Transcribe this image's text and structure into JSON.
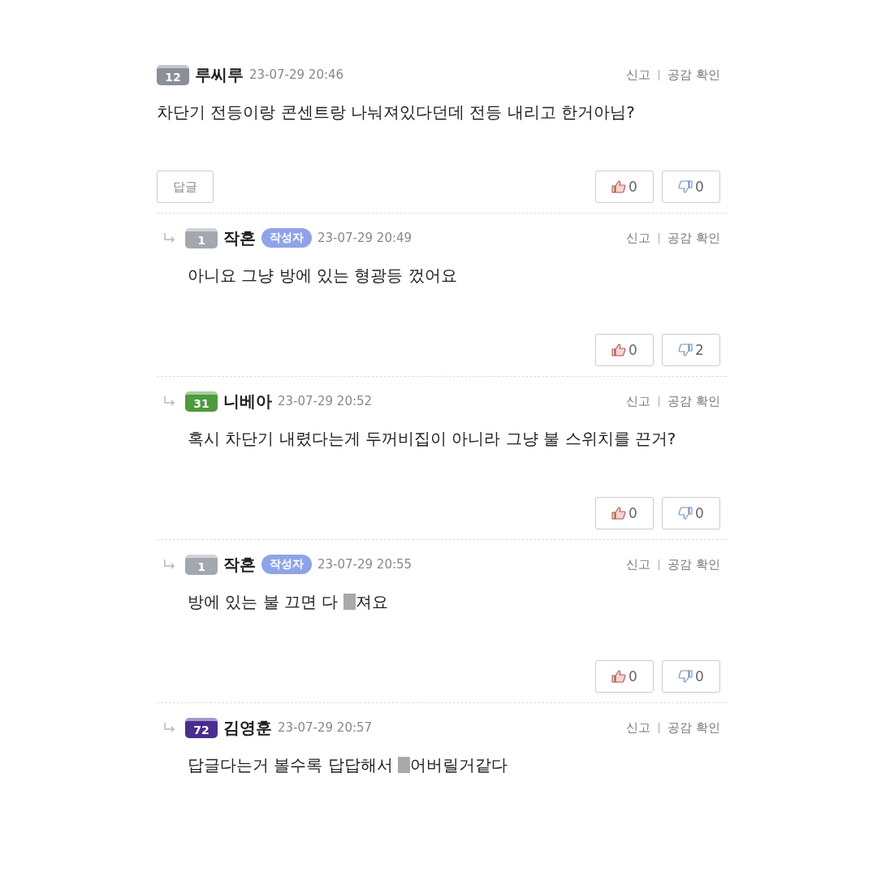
{
  "comments": [
    {
      "kind": "comment",
      "level": "12",
      "color": "#8a8f99",
      "author": "루씨루",
      "date": "23-07-29 20:46",
      "report": "신고",
      "likes_link": "공감 확인",
      "body": [
        {
          "kind": "text",
          "text": "차단기 전등이랑 콘센트랑 나눠져있다던데 전등 내리고 한거아님?"
        }
      ],
      "reply_button": "답글",
      "upvotes": "0",
      "downvotes": "0"
    },
    {
      "kind": "reply",
      "level": "1",
      "color": "#a3a7ae",
      "author": "작혼",
      "author_badge": "작성자",
      "date": "23-07-29 20:49",
      "report": "신고",
      "likes_link": "공감 확인",
      "body": [
        {
          "kind": "text",
          "text": "아니요 그냥 방에 있는 형광등 껐어요"
        }
      ],
      "upvotes": "0",
      "downvotes": "2"
    },
    {
      "kind": "reply",
      "level": "31",
      "color": "#4e9a3c",
      "author": "니베아",
      "date": "23-07-29 20:52",
      "report": "신고",
      "likes_link": "공감 확인",
      "body": [
        {
          "kind": "text",
          "text": "혹시 차단기 내렸다는게 두꺼비집이 아니라 그냥 불 스위치를 끈거?"
        }
      ],
      "upvotes": "0",
      "downvotes": "0"
    },
    {
      "kind": "reply",
      "level": "1",
      "color": "#a3a7ae",
      "author": "작혼",
      "author_badge": "작성자",
      "date": "23-07-29 20:55",
      "report": "신고",
      "likes_link": "공감 확인",
      "body": [
        {
          "kind": "text",
          "text": "방에 있는 불 끄면 다 "
        },
        {
          "kind": "censored"
        },
        {
          "kind": "text",
          "text": "져요"
        }
      ],
      "upvotes": "0",
      "downvotes": "0"
    },
    {
      "kind": "reply",
      "level": "72",
      "color": "#4b2c8f",
      "author": "김영훈",
      "date": "23-07-29 20:57",
      "report": "신고",
      "likes_link": "공감 확인",
      "body": [
        {
          "kind": "text",
          "text": "답글다는거 볼수록 답답해서 "
        },
        {
          "kind": "censored"
        },
        {
          "kind": "text",
          "text": "어버릴거같다"
        }
      ]
    }
  ]
}
